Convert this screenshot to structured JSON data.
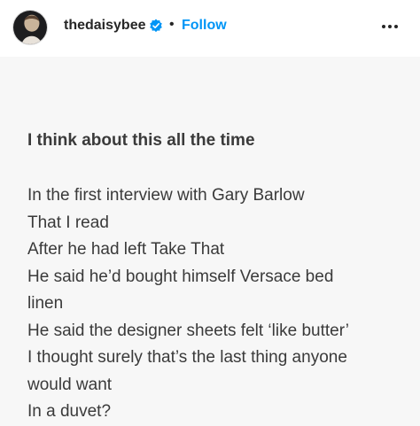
{
  "header": {
    "username": "thedaisybee",
    "separator": "•",
    "follow_label": "Follow",
    "verified_icon": "verified-badge-icon",
    "more_icon": "more-options-icon",
    "accent_color": "#0095f6"
  },
  "post": {
    "title": "I think about this all the time",
    "lines": [
      "In the first interview with Gary Barlow",
      "That I read",
      "After he had left Take That",
      "He said he’d bought himself Versace bed",
      "linen",
      "He said the designer sheets felt ‘like butter’",
      "I thought surely that’s the last thing anyone",
      "would want",
      "In a duvet?"
    ]
  }
}
